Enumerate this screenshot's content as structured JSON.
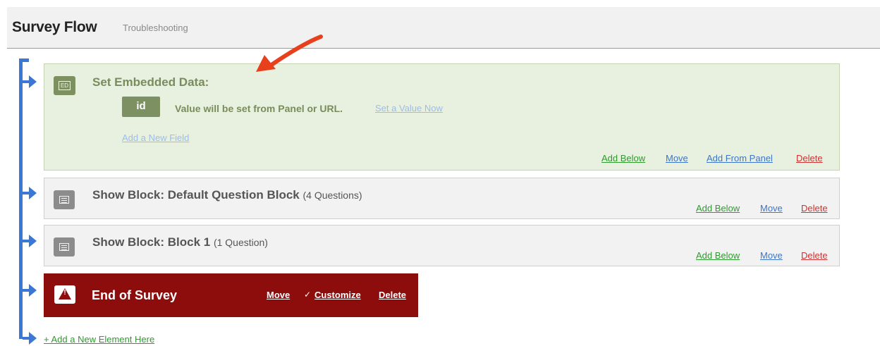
{
  "header": {
    "title": "Survey Flow",
    "subtitle": "Troubleshooting"
  },
  "embedded_data": {
    "icon_label": "ED",
    "title": "Set Embedded Data:",
    "field_name": "id",
    "field_status": "Value will be set from Panel or URL.",
    "set_value_link": "Set a Value Now",
    "add_field_link": "Add a New Field",
    "actions": {
      "add_below": "Add Below",
      "move": "Move",
      "add_from_panel": "Add From Panel",
      "delete": "Delete"
    }
  },
  "blocks": [
    {
      "title": "Show Block: Default Question Block",
      "count": "(4 Questions)",
      "actions": {
        "add_below": "Add Below",
        "move": "Move",
        "delete": "Delete"
      }
    },
    {
      "title": "Show Block: Block 1",
      "count": "(1 Question)",
      "actions": {
        "add_below": "Add Below",
        "move": "Move",
        "delete": "Delete"
      }
    }
  ],
  "end_of_survey": {
    "title": "End of Survey",
    "move": "Move",
    "customize": "Customize",
    "delete": "Delete"
  },
  "add_element_link": "+ Add a New Element Here",
  "colors": {
    "flow_line": "#3b78d6",
    "end_bg": "#8d0d0d",
    "embedded_bg": "#e8f0df",
    "annotation_arrow": "#e8401c"
  }
}
